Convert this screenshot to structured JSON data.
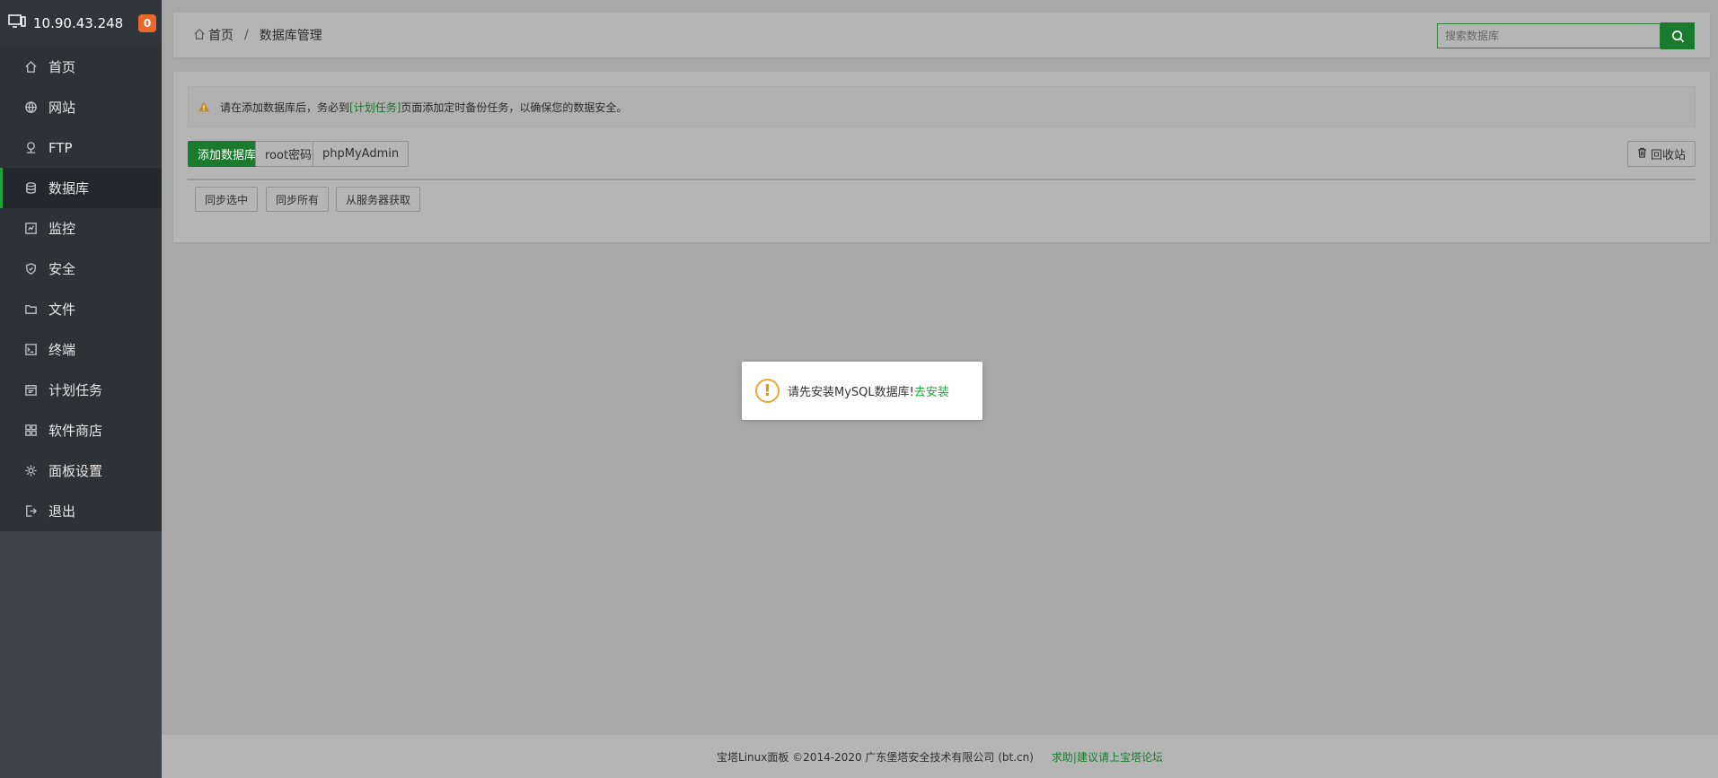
{
  "header": {
    "ip": "10.90.43.248",
    "notice_count": "0"
  },
  "sidebar": {
    "items": [
      {
        "label": "首页",
        "icon": "home-icon"
      },
      {
        "label": "网站",
        "icon": "globe-icon"
      },
      {
        "label": "FTP",
        "icon": "ftp-icon"
      },
      {
        "label": "数据库",
        "icon": "database-icon",
        "active": true
      },
      {
        "label": "监控",
        "icon": "monitor-icon"
      },
      {
        "label": "安全",
        "icon": "shield-icon"
      },
      {
        "label": "文件",
        "icon": "folder-icon"
      },
      {
        "label": "终端",
        "icon": "terminal-icon"
      },
      {
        "label": "计划任务",
        "icon": "calendar-icon"
      },
      {
        "label": "软件商店",
        "icon": "apps-icon"
      },
      {
        "label": "面板设置",
        "icon": "gear-icon"
      },
      {
        "label": "退出",
        "icon": "logout-icon"
      }
    ]
  },
  "breadcrumb": {
    "home": "首页",
    "sep": "/",
    "current": "数据库管理"
  },
  "search": {
    "placeholder": "搜索数据库"
  },
  "alert": {
    "prefix": "请在添加数据库后，务必到",
    "link": "[计划任务]",
    "suffix": "页面添加定时备份任务，以确保您的数据安全。"
  },
  "toolbar": {
    "add_db": "添加数据库",
    "root_pwd": "root密码",
    "phpmyadmin": "phpMyAdmin",
    "recycle": "回收站",
    "sync_selected": "同步选中",
    "sync_all": "同步所有",
    "fetch_server": "从服务器获取"
  },
  "dialog": {
    "message": "请先安装MySQL数据库!",
    "action": "去安装"
  },
  "footer": {
    "copyright": "宝塔Linux面板 ©2014-2020 广东堡塔安全技术有限公司 (bt.cn)",
    "help": "求助|建议请上宝塔论坛"
  },
  "colors": {
    "accent": "#20a53a",
    "sidebar": "#3d444c",
    "badge": "#e8682b"
  }
}
